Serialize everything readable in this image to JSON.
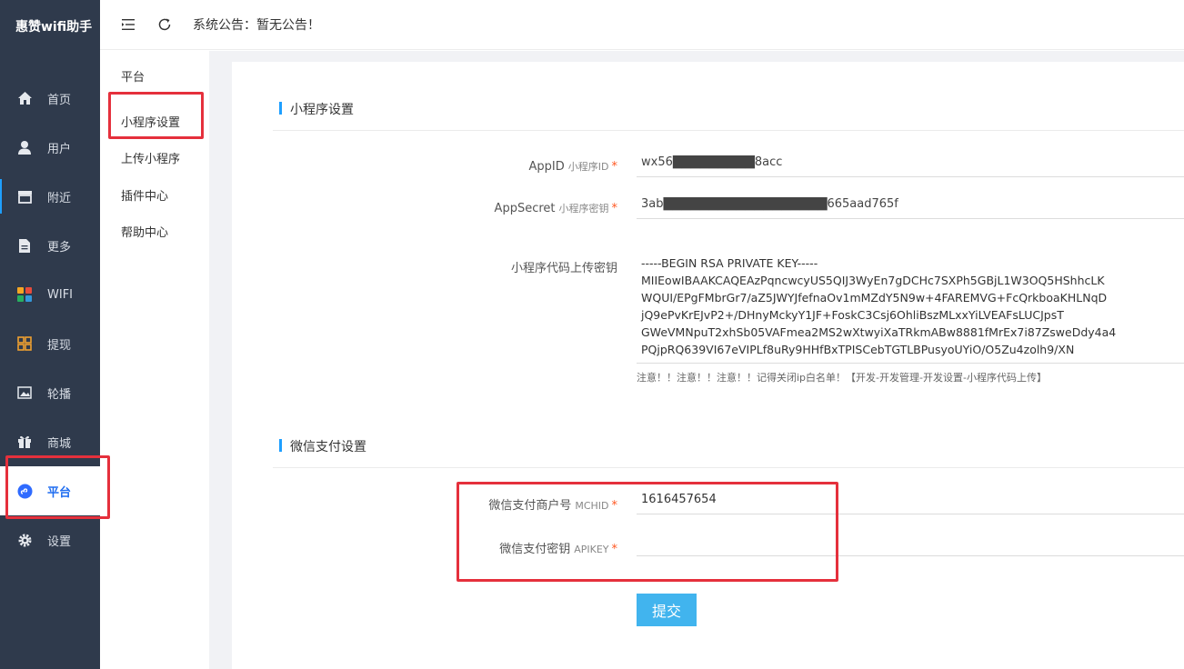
{
  "brand": {
    "title": "惠赞wifi助手"
  },
  "sidebar": {
    "items": [
      {
        "label": "首页",
        "icon": "home-icon"
      },
      {
        "label": "用户",
        "icon": "user-icon"
      },
      {
        "label": "附近",
        "icon": "store-icon"
      },
      {
        "label": "更多",
        "icon": "document-icon"
      },
      {
        "label": "WIFI",
        "icon": "grid-app-icon"
      },
      {
        "label": "提现",
        "icon": "grid-icon"
      },
      {
        "label": "轮播",
        "icon": "image-icon"
      },
      {
        "label": "商城",
        "icon": "gift-icon"
      },
      {
        "label": "平台",
        "icon": "miniprogram-icon"
      },
      {
        "label": "设置",
        "icon": "gear-icon"
      }
    ],
    "active_index": 8
  },
  "topbar": {
    "notice": "系统公告：暂无公告！"
  },
  "submenu": {
    "items": [
      {
        "label": "平台"
      },
      {
        "label": "小程序设置"
      },
      {
        "label": "上传小程序"
      },
      {
        "label": "插件中心"
      },
      {
        "label": "帮助中心"
      }
    ]
  },
  "miniprogram": {
    "section_title": "小程序设置",
    "appid": {
      "label": "AppID",
      "hint": "小程序ID",
      "required": "*",
      "value": "wx56█████████8acc"
    },
    "appsecret": {
      "label": "AppSecret",
      "hint": "小程序密钥",
      "required": "*",
      "value": "3ab██████████████████665aad765f"
    },
    "upload_key": {
      "label": "小程序代码上传密钥",
      "value": "-----BEGIN RSA PRIVATE KEY-----\nMIIEowIBAAKCAQEAzPqncwcyUS5QIJ3WyEn7gDCHc7SXPh5GBjL1W3OQ5HShhcLK\nWQUI/EPgFMbrGr7/aZ5JWYJfefnaOv1mMZdY5N9w+4FAREMVG+FcQrkboaKHLNqD\njQ9ePvKrEJvP2+/DHnyMckyY1JF+FoskC3Csj6OhliBszMLxxYiLVEAFsLUCJpsT\nGWeVMNpuT2xhSb05VAFmea2MS2wXtwyiXaTRkmABw8881fMrEx7i87ZsweDdy4a4\nPQjpRQ639VI67eVIPLf8uRy9HHfBxTPISCebTGTLBPusyoUYiO/O5Zu4zolh9/XN\n"
    },
    "note": "注意！！注意！！注意！！记得关闭ip白名单！【开发-开发管理-开发设置-小程序代码上传】"
  },
  "wechatpay": {
    "section_title": "微信支付设置",
    "mchid": {
      "label": "微信支付商户号",
      "hint": "MCHID",
      "required": "*",
      "value": "1616457654"
    },
    "apikey": {
      "label": "微信支付密钥",
      "hint": "APIKEY",
      "required": "*",
      "value": ""
    }
  },
  "actions": {
    "submit_label": "提交"
  },
  "colors": {
    "sidebar_bg": "#2f3a4c",
    "accent": "#1e9fff",
    "submit_bg": "#41b4ee",
    "annotation_red": "#e5303c",
    "required": "#ff5722"
  }
}
